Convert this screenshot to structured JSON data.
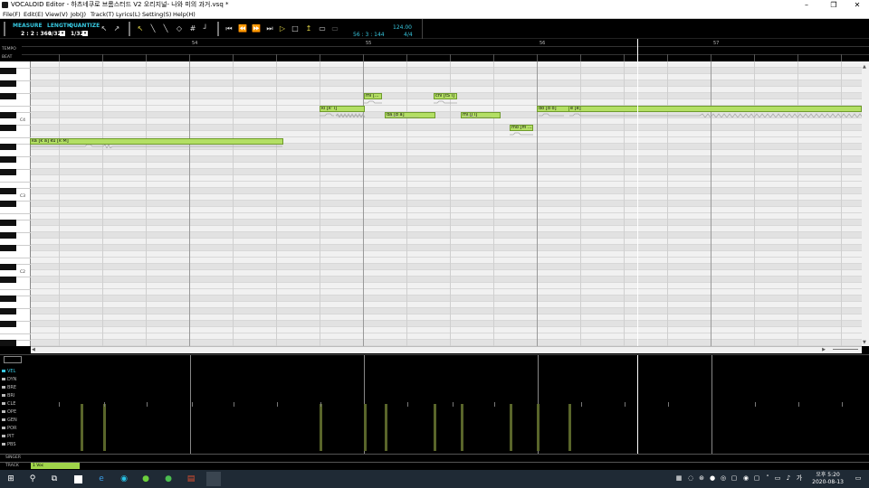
{
  "window": {
    "title": "VOCALOID Editor - 하츠네쿠로 브롬스터드 V2 오리지널- 나와 미의 과거.vsq *",
    "minimize": "–",
    "maximize": "❐",
    "close": "✕"
  },
  "menu": [
    "File(F)",
    "Edit(E)",
    "View(V)",
    "Job(J)",
    "Track(T)",
    "Lyrics(L)",
    "Setting(S)",
    "Help(H)"
  ],
  "toolbar": {
    "measure_label": "MEASURE",
    "measure_value": "2 : 2 : 360",
    "length_label": "LENGTH",
    "length_value": "1/32",
    "quantize_label": "QUANTIZE",
    "quantize_value": "1/32",
    "position": "56 : 3 : 144",
    "tempo": "124.00",
    "time_signature": "4/4",
    "icons": [
      "arrow-select-icon",
      "arrow-pointer-icon",
      "pencil-icon",
      "line-icon",
      "eraser-icon",
      "grid-icon",
      "snap-icon",
      "rewind-start-icon",
      "rewind-icon",
      "fast-forward-icon",
      "forward-end-icon",
      "play-icon",
      "stop-icon",
      "auto-scroll-icon",
      "loop-icon",
      "playback-icon"
    ]
  },
  "ruler": {
    "tempo_label": "TEMPO",
    "beat_label": "BEAT",
    "measures": [
      "54",
      "55",
      "56",
      "57"
    ]
  },
  "octaves": [
    "C4",
    "C3",
    "C2"
  ],
  "notes": [
    {
      "lyric": "ka [k a] ku [k M]",
      "id": "n1"
    },
    {
      "lyric": "ki [k' i]",
      "id": "n2"
    },
    {
      "lyric": "mi [...",
      "id": "n3"
    },
    {
      "lyric": "da [d a]",
      "id": "n4"
    },
    {
      "lyric": "chi [tS i]",
      "id": "n5"
    },
    {
      "lyric": "mi [J i]",
      "id": "n6"
    },
    {
      "lyric": "mo [m ...",
      "id": "n7"
    },
    {
      "lyric": "do [d o]",
      "id": "n8"
    },
    {
      "lyric": "e [e]",
      "id": "n9"
    }
  ],
  "controls": [
    "VEL",
    "DYN",
    "BRE",
    "BRI",
    "CLE",
    "OPE",
    "GEN",
    "POR",
    "PIT",
    "PBS"
  ],
  "singer_label": "SINGER",
  "track_label": "TRACK",
  "track_tab": "1 Voc",
  "clock": {
    "time": "오후 5:20",
    "date": "2020-08-13"
  },
  "tray_ime": "가",
  "colors": {
    "note_fill": "#b3df64",
    "accent_cyan": "#37c8e0",
    "velocity": "#59652a"
  }
}
